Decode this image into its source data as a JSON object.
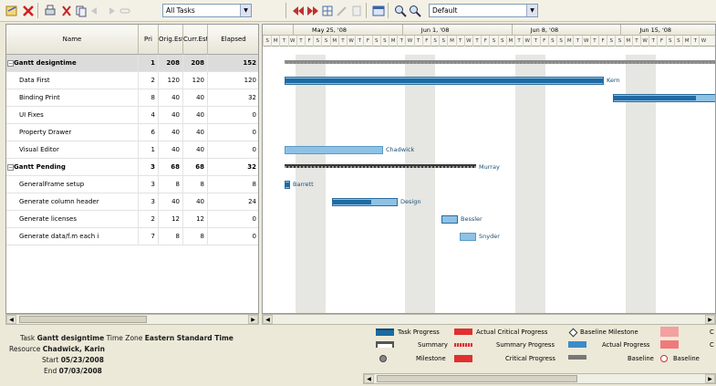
{
  "toolbar": {
    "filter_value": "All Tasks",
    "view_value": "Default",
    "icons": [
      "open-icon",
      "delete-icon",
      "print-icon",
      "cut-icon",
      "copy-icon",
      "indent-icon",
      "outdent-icon",
      "link-icon",
      "unlink-icon",
      "zoom-in-icon",
      "zoom-out-icon",
      "calendar-icon",
      "find-icon",
      "find-next-icon"
    ]
  },
  "grid": {
    "columns": [
      "Name",
      "Pri",
      "Orig.Est",
      "Curr.Est",
      "Elapsed"
    ],
    "rows": [
      {
        "name": "Gantt designtime",
        "pri": "1",
        "orig": "208",
        "curr": "208",
        "elapsed": "152",
        "summary": true,
        "selected": true
      },
      {
        "name": "Data First",
        "pri": "2",
        "orig": "120",
        "curr": "120",
        "elapsed": "120"
      },
      {
        "name": "Binding Print",
        "pri": "8",
        "orig": "40",
        "curr": "40",
        "elapsed": "32"
      },
      {
        "name": "UI Fixes",
        "pri": "4",
        "orig": "40",
        "curr": "40",
        "elapsed": "0"
      },
      {
        "name": "Property Drawer",
        "pri": "6",
        "orig": "40",
        "curr": "40",
        "elapsed": "0"
      },
      {
        "name": "Visual Editor",
        "pri": "1",
        "orig": "40",
        "curr": "40",
        "elapsed": "0"
      },
      {
        "name": "Gantt Pending",
        "pri": "3",
        "orig": "68",
        "curr": "68",
        "elapsed": "32",
        "summary": true
      },
      {
        "name": "GeneralFrame setup",
        "pri": "3",
        "orig": "8",
        "curr": "8",
        "elapsed": "8"
      },
      {
        "name": "Generate column header",
        "pri": "3",
        "orig": "40",
        "curr": "40",
        "elapsed": "24"
      },
      {
        "name": "Generate licenses",
        "pri": "2",
        "orig": "12",
        "curr": "12",
        "elapsed": "0"
      },
      {
        "name": "Generate data/f.m each i",
        "pri": "7",
        "orig": "8",
        "curr": "8",
        "elapsed": "0"
      }
    ]
  },
  "timeline": {
    "weeks": [
      "May 25, '08",
      "Jun 1, '08",
      "Jun 8, '08",
      "Jun 15, '08"
    ],
    "days": [
      "S",
      "M",
      "T",
      "W",
      "T",
      "F",
      "S",
      "S",
      "M",
      "T",
      "W",
      "T",
      "F",
      "S",
      "S",
      "M",
      "T",
      "W",
      "T",
      "F",
      "S",
      "S",
      "M",
      "T",
      "W",
      "T",
      "F",
      "S",
      "S",
      "M",
      "T",
      "W",
      "T",
      "F",
      "S",
      "S",
      "M",
      "T",
      "W",
      "T",
      "F",
      "S",
      "S",
      "M",
      "T",
      "W",
      "T",
      "F",
      "S",
      "S",
      "M",
      "T",
      "W"
    ],
    "bar_labels": {
      "data_first": "Kern",
      "visual_editor": "Chadwick",
      "pending": "Murray",
      "general": "Barrett",
      "column": "Design",
      "licenses": "Bessler",
      "dataf": "Snyder"
    }
  },
  "info": {
    "task_label": "Task",
    "task_value": "Gantt designtime",
    "tz_label": "Time Zone",
    "tz_value": "Eastern Standard Time",
    "resource_label": "Resource",
    "resource_value": "Chadwick, Karin",
    "start_label": "Start",
    "start_value": "05/23/2008",
    "end_label": "End",
    "end_value": "07/03/2008"
  },
  "legend": {
    "task_progress": "Task Progress",
    "actual_critical_progress": "Actual Critical Progress",
    "baseline_milestone": "Baseline Milestone",
    "summary": "Summary",
    "summary_progress": "Summary Progress",
    "actual_progress": "Actual Progress",
    "milestone": "Milestone",
    "critical_progress": "Critical Progress",
    "baseline": "Baseline",
    "baseline2": "Baseline",
    "clipped1": "C",
    "clipped2": "C"
  },
  "colors": {
    "task_blue": "#2a7db5",
    "task_light": "#8cc0e0",
    "summary_dark": "#555555",
    "critical_red": "#e03030",
    "baseline_pink": "#f08a8a",
    "weekend_gray": "#e6e6e2"
  }
}
